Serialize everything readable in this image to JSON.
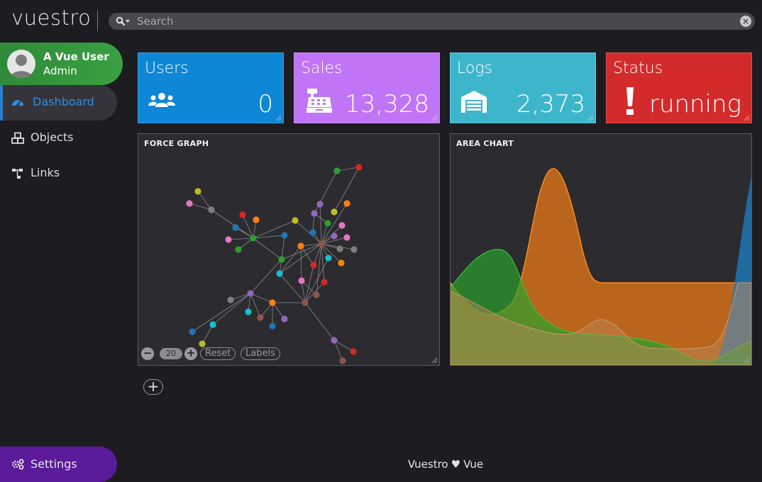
{
  "brand": "vuestro",
  "search": {
    "placeholder": "Search",
    "value": ""
  },
  "user": {
    "name": "A Vue User",
    "role": "Admin"
  },
  "nav": [
    {
      "label": "Dashboard",
      "icon": "dashboard-gauge-icon",
      "active": true
    },
    {
      "label": "Objects",
      "icon": "cubes-icon"
    },
    {
      "label": "Links",
      "icon": "sitemap-icon"
    }
  ],
  "settings": {
    "label": "Settings",
    "icon": "cogs-icon"
  },
  "cards": [
    {
      "title": "Users",
      "value": "0",
      "icon": "users-icon",
      "color": "#0d87d6"
    },
    {
      "title": "Sales",
      "value": "13,328",
      "icon": "cash-register-icon",
      "color": "#c075f7"
    },
    {
      "title": "Logs",
      "value": "2,373",
      "icon": "warehouse-icon",
      "color": "#3db6cc"
    },
    {
      "title": "Status",
      "value": "running",
      "icon": "exclamation-icon",
      "color": "#d32b2b"
    }
  ],
  "panels": {
    "force_graph": {
      "title": "FORCE GRAPH",
      "zoom": "20",
      "reset_label": "Reset",
      "labels_label": "Labels"
    },
    "area_chart": {
      "title": "AREA CHART"
    }
  },
  "footer": {
    "left": "Vuestro",
    "icon": "heart-icon",
    "right": "Vue"
  },
  "colors": {
    "background": "#1c1c21",
    "panel": "#2b2b30",
    "active": "#2f8cdf",
    "user_card": "#3aa043",
    "settings": "#5a1a9a"
  }
}
